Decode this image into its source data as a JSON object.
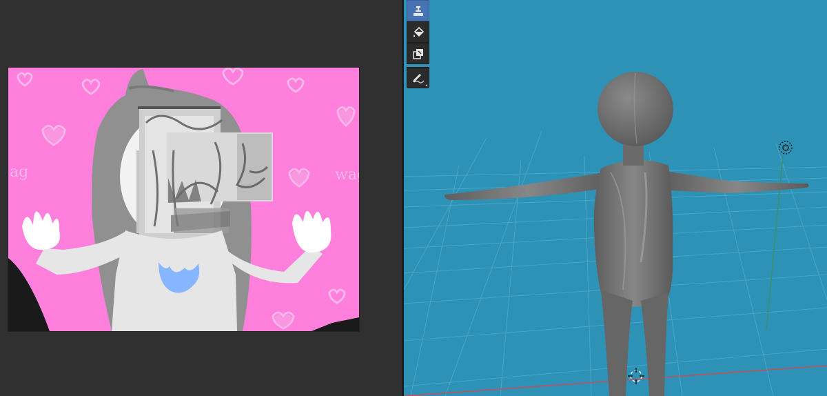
{
  "image_editor": {
    "canvas_background": "#ff7fdc",
    "handwritten_text": [
      "ag",
      "wag"
    ]
  },
  "viewport": {
    "background": "#2d92b6",
    "grid_color": "#4aa7c7",
    "x_axis_color": "#c8505a",
    "model_color": "#6e6e6e"
  },
  "toolbar": {
    "tools": [
      {
        "name": "brush-tool",
        "icon": "brush-icon",
        "active": true
      },
      {
        "name": "fill-tool",
        "icon": "fill-bucket-icon",
        "active": false
      },
      {
        "name": "clone-tool",
        "icon": "clone-icon",
        "active": false
      },
      {
        "name": "annotate-tool",
        "icon": "annotate-pencil-icon",
        "active": false
      }
    ]
  },
  "colors": {
    "editor_bg": "#303030",
    "active_tool": "#4772b3",
    "tool_bg": "#2b2b2b"
  }
}
